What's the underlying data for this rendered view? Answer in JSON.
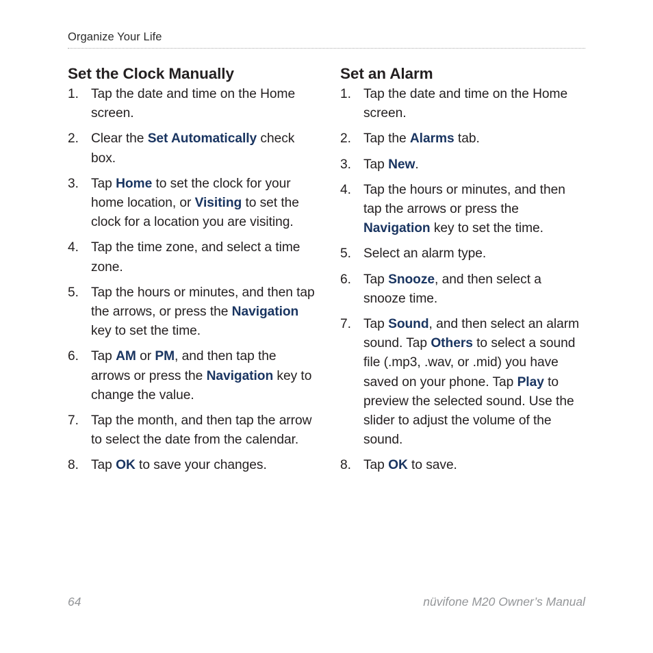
{
  "header": {
    "section_title": "Organize Your Life"
  },
  "columns": {
    "left": {
      "heading": "Set the Clock Manually",
      "steps": [
        {
          "num": "1.",
          "parts": [
            {
              "t": "Tap the date and time on the Home screen.",
              "b": false
            }
          ]
        },
        {
          "num": "2.",
          "parts": [
            {
              "t": "Clear the ",
              "b": false
            },
            {
              "t": "Set Automatically",
              "b": true
            },
            {
              "t": " check box.",
              "b": false
            }
          ]
        },
        {
          "num": "3.",
          "parts": [
            {
              "t": "Tap ",
              "b": false
            },
            {
              "t": "Home",
              "b": true
            },
            {
              "t": " to set the clock for your home location, or ",
              "b": false
            },
            {
              "t": "Visiting",
              "b": true
            },
            {
              "t": " to set the clock for a location you are visiting.",
              "b": false
            }
          ]
        },
        {
          "num": "4.",
          "parts": [
            {
              "t": "Tap the time zone, and select a time zone.",
              "b": false
            }
          ]
        },
        {
          "num": "5.",
          "parts": [
            {
              "t": "Tap the hours or minutes, and then tap the arrows, or press the ",
              "b": false
            },
            {
              "t": "Navigation",
              "b": true
            },
            {
              "t": " key to set the time.",
              "b": false
            }
          ]
        },
        {
          "num": "6.",
          "parts": [
            {
              "t": "Tap ",
              "b": false
            },
            {
              "t": "AM",
              "b": true
            },
            {
              "t": " or ",
              "b": false
            },
            {
              "t": "PM",
              "b": true
            },
            {
              "t": ", and then tap the arrows or press the ",
              "b": false
            },
            {
              "t": "Navigation",
              "b": true
            },
            {
              "t": " key to change the value.",
              "b": false
            }
          ]
        },
        {
          "num": "7.",
          "parts": [
            {
              "t": "Tap the month, and then tap the arrow to select the date from the calendar.",
              "b": false
            }
          ]
        },
        {
          "num": "8.",
          "parts": [
            {
              "t": "Tap ",
              "b": false
            },
            {
              "t": "OK",
              "b": true
            },
            {
              "t": " to save your changes.",
              "b": false
            }
          ]
        }
      ]
    },
    "right": {
      "heading": "Set an Alarm",
      "steps": [
        {
          "num": "1.",
          "parts": [
            {
              "t": "Tap the date and time on the Home screen.",
              "b": false
            }
          ]
        },
        {
          "num": "2.",
          "parts": [
            {
              "t": "Tap the ",
              "b": false
            },
            {
              "t": "Alarms",
              "b": true
            },
            {
              "t": " tab.",
              "b": false
            }
          ]
        },
        {
          "num": "3.",
          "parts": [
            {
              "t": "Tap ",
              "b": false
            },
            {
              "t": "New",
              "b": true
            },
            {
              "t": ".",
              "b": false
            }
          ]
        },
        {
          "num": "4.",
          "parts": [
            {
              "t": "Tap the hours or minutes, and then tap the arrows or press the ",
              "b": false
            },
            {
              "t": "Navigation",
              "b": true
            },
            {
              "t": " key to set the time.",
              "b": false
            }
          ]
        },
        {
          "num": "5.",
          "parts": [
            {
              "t": "Select an alarm type.",
              "b": false
            }
          ]
        },
        {
          "num": "6.",
          "parts": [
            {
              "t": "Tap ",
              "b": false
            },
            {
              "t": "Snooze",
              "b": true
            },
            {
              "t": ", and then select a snooze time.",
              "b": false
            }
          ]
        },
        {
          "num": "7.",
          "parts": [
            {
              "t": "Tap ",
              "b": false
            },
            {
              "t": "Sound",
              "b": true
            },
            {
              "t": ", and then select an alarm sound. Tap ",
              "b": false
            },
            {
              "t": "Others",
              "b": true
            },
            {
              "t": " to select a sound file (.mp3, .wav, or .mid) you have saved on your phone. Tap ",
              "b": false
            },
            {
              "t": "Play",
              "b": true
            },
            {
              "t": " to preview the selected sound. Use the slider to adjust the volume of the sound.",
              "b": false
            }
          ]
        },
        {
          "num": "8.",
          "parts": [
            {
              "t": "Tap ",
              "b": false
            },
            {
              "t": "OK",
              "b": true
            },
            {
              "t": " to save.",
              "b": false
            }
          ]
        }
      ]
    }
  },
  "footer": {
    "page_number": "64",
    "manual_title": "nüvifone M20 Owner’s Manual"
  },
  "colors": {
    "body_text": "#231f20",
    "ui_term": "#1a3561",
    "footer_text": "#939598",
    "rule": "#a9a9a9",
    "page_background": "#ffffff"
  }
}
